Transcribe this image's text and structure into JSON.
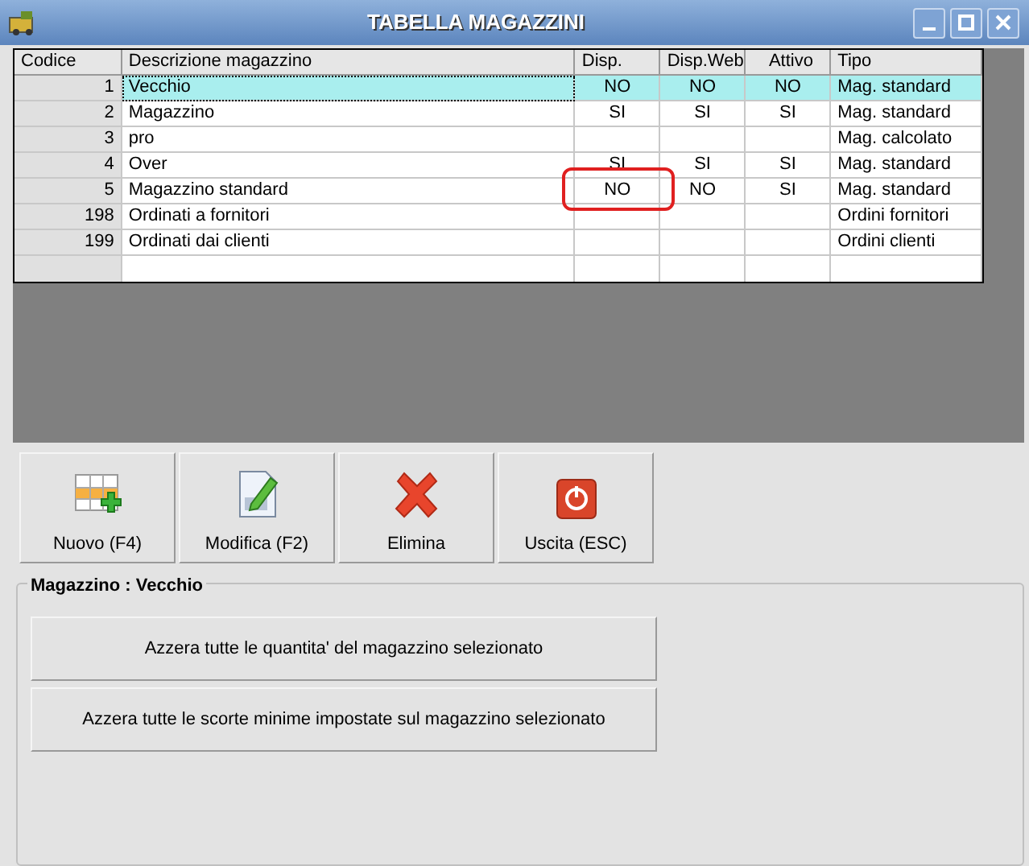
{
  "window": {
    "title": "TABELLA MAGAZZINI"
  },
  "table": {
    "columns": [
      "Codice",
      "Descrizione magazzino",
      "Disp.",
      "Disp.Web",
      "Attivo",
      "Tipo"
    ],
    "rows": [
      {
        "selected": true,
        "cells": [
          "1",
          "Vecchio",
          "NO",
          "NO",
          "NO",
          "Mag. standard"
        ]
      },
      {
        "selected": false,
        "cells": [
          "2",
          "Magazzino",
          "SI",
          "SI",
          "SI",
          "Mag. standard"
        ]
      },
      {
        "selected": false,
        "cells": [
          "3",
          "pro",
          "",
          "",
          "",
          "Mag. calcolato"
        ]
      },
      {
        "selected": false,
        "cells": [
          "4",
          "Over",
          "SI",
          "SI",
          "SI",
          "Mag. standard"
        ]
      },
      {
        "selected": false,
        "cells": [
          "5",
          "Magazzino standard",
          "NO",
          "NO",
          "SI",
          "Mag. standard"
        ]
      },
      {
        "selected": false,
        "cells": [
          "198",
          "Ordinati a fornitori",
          "",
          "",
          "",
          "Ordini fornitori"
        ]
      },
      {
        "selected": false,
        "cells": [
          "199",
          "Ordinati dai clienti",
          "",
          "",
          "",
          "Ordini clienti"
        ]
      }
    ]
  },
  "toolbar": [
    {
      "kind": "new",
      "label": "Nuovo (F4)"
    },
    {
      "kind": "edit",
      "label": "Modifica (F2)"
    },
    {
      "kind": "delete",
      "label": "Elimina"
    },
    {
      "kind": "exit",
      "label": "Uscita (ESC)"
    }
  ],
  "group": {
    "title": "Magazzino : Vecchio",
    "actions": [
      "Azzera tutte le quantita' del magazzino selezionato",
      "Azzera tutte le scorte minime impostate sul magazzino selezionato"
    ]
  }
}
